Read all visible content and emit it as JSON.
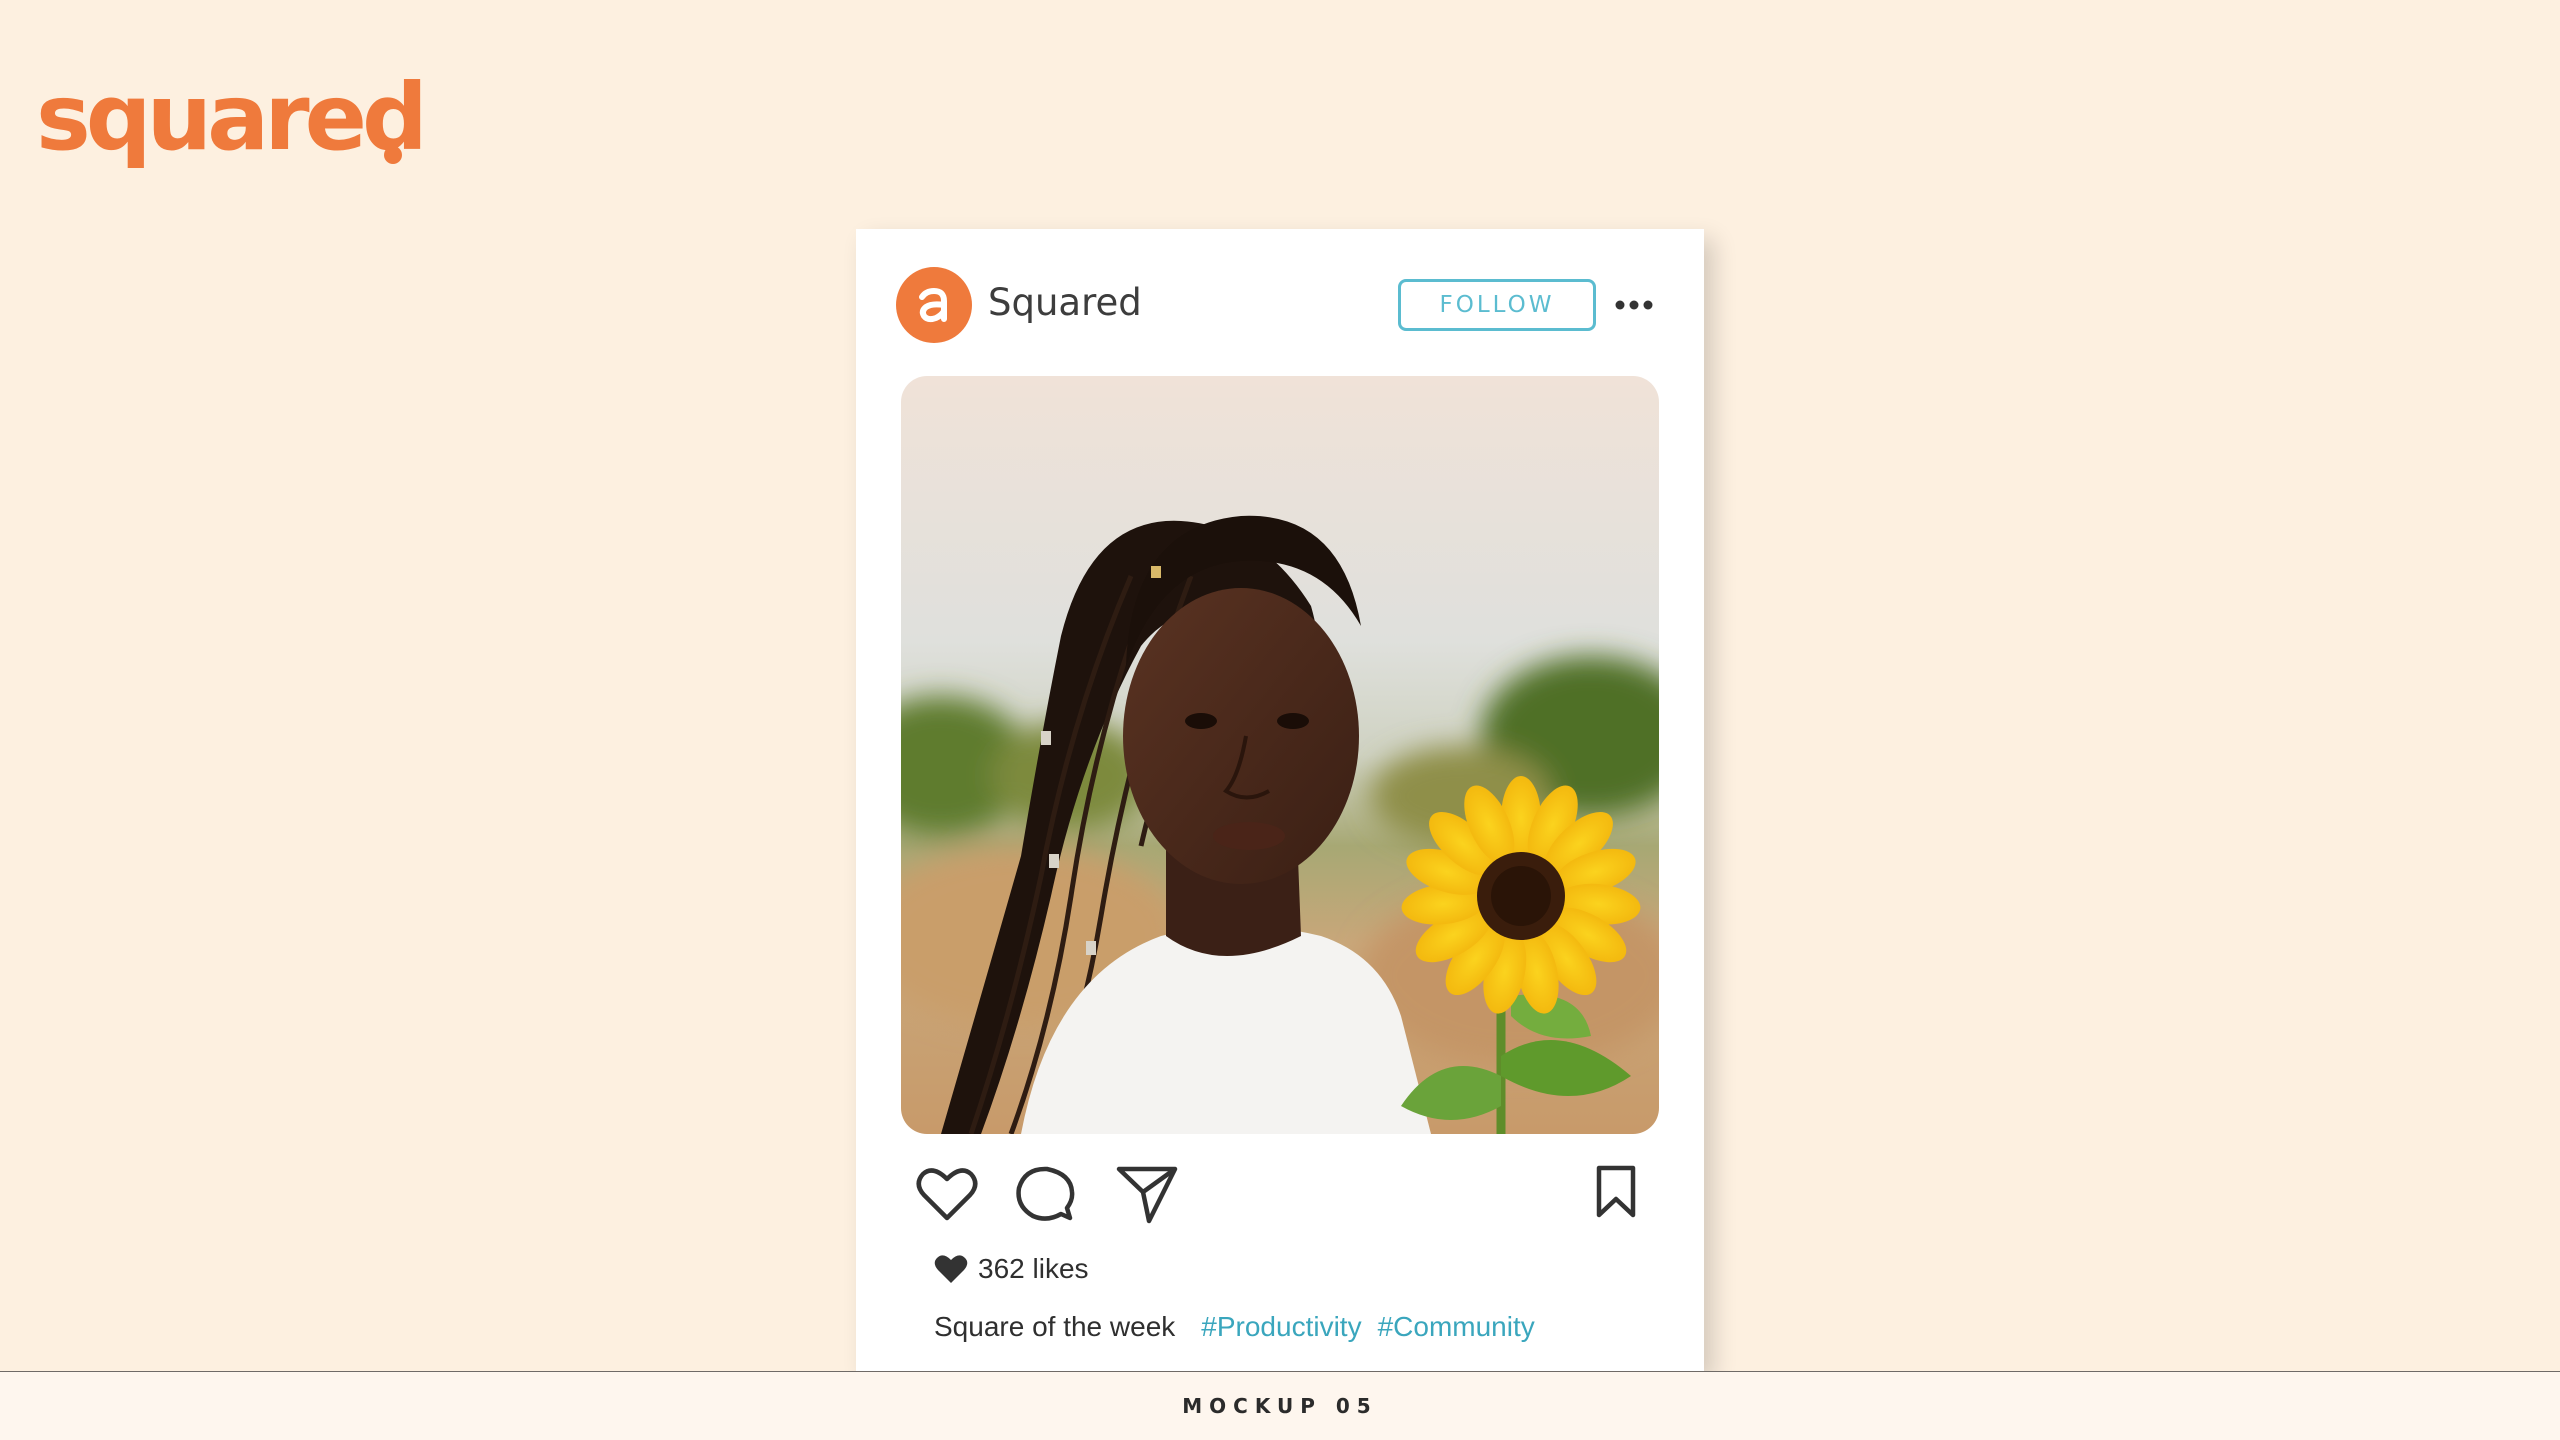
{
  "brand": {
    "logo_text": "squared",
    "color": "#ef7a3c"
  },
  "post": {
    "account_name": "Squared",
    "avatar_letter": "a",
    "follow_label": "FOLLOW",
    "follow_color": "#5bbcd0",
    "photo_icon": "portrait-with-sunflower-photo",
    "likes": "362 likes",
    "caption": "Square of the week",
    "hashtags": [
      "#Productivity",
      "#Community"
    ],
    "hashtag_color": "#3aa6bd",
    "actions": [
      "heart-icon",
      "comment-icon",
      "share-icon",
      "bookmark-icon"
    ],
    "more_icon": "more-options-icon"
  },
  "footer": {
    "label": "MOCKUP 05"
  }
}
